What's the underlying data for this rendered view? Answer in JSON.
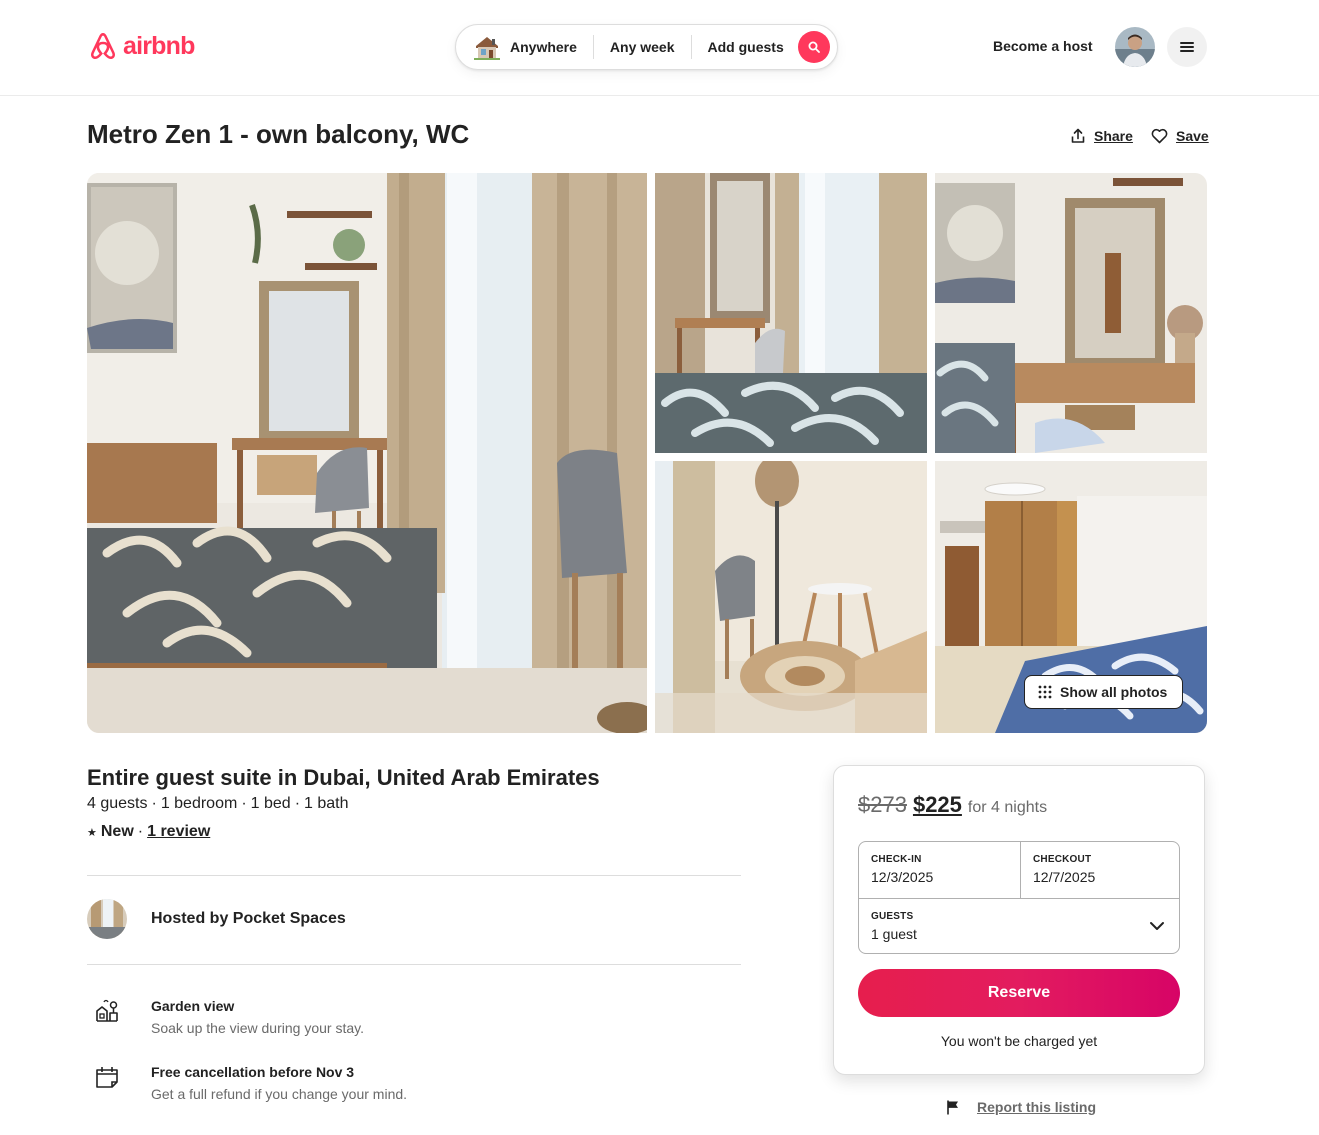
{
  "header": {
    "logo_text": "airbnb",
    "search": {
      "location": "Anywhere",
      "dates": "Any week",
      "guests": "Add guests"
    },
    "become_host": "Become a host"
  },
  "listing": {
    "title": "Metro Zen 1 - own balcony, WC",
    "share_label": "Share",
    "save_label": "Save",
    "show_all_photos": "Show all photos",
    "subtitle": "Entire guest suite in Dubai, United Arab Emirates",
    "specs": [
      "4 guests",
      "1 bedroom",
      "1 bed",
      "1 bath"
    ],
    "spec_separator": "·",
    "rating": {
      "star": "★",
      "status": "New",
      "separator": "·",
      "reviews": "1 review"
    },
    "host": {
      "label": "Hosted by Pocket Spaces"
    },
    "highlights": [
      {
        "icon": "garden-view-icon",
        "title": "Garden view",
        "description": "Soak up the view during your stay."
      },
      {
        "icon": "calendar-icon",
        "title": "Free cancellation before Nov 3",
        "description": "Get a full refund if you change your mind."
      }
    ]
  },
  "booking": {
    "old_price": "$273",
    "new_price": "$225",
    "nights_label": "for 4 nights",
    "checkin_label": "CHECK-IN",
    "checkin_value": "12/3/2025",
    "checkout_label": "CHECKOUT",
    "checkout_value": "12/7/2025",
    "guests_label": "GUESTS",
    "guests_value": "1 guest",
    "reserve_label": "Reserve",
    "charge_note": "You won't be charged yet"
  },
  "report_label": "Report this listing",
  "colors": {
    "brand": "#ff385c",
    "text": "#222222",
    "muted": "#6a6a6a",
    "border": "#dddddd"
  }
}
